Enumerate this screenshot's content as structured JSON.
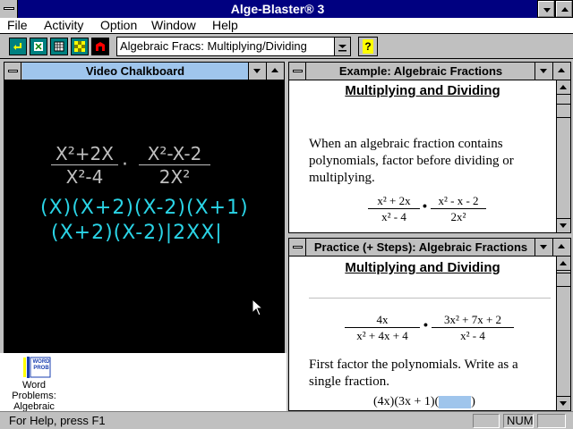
{
  "app": {
    "title": "Alge-Blaster® 3"
  },
  "menu": [
    "File",
    "Activity",
    "Option",
    "Window",
    "Help"
  ],
  "toolbar": {
    "activity_value": "Algebraic Fracs: Multiplying/Dividing",
    "help_glyph": "?"
  },
  "chalkboard": {
    "title": "Video Chalkboard",
    "expr1": {
      "num1": "X²+2X",
      "den1": "X²-4",
      "op": "·",
      "num2": "X²-X-2",
      "den2": "2X²"
    },
    "work_num": "(X)(X+2)(X-2)(X+1)",
    "work_den": "(X+2)(X-2)|2XX|"
  },
  "example": {
    "title": "Example: Algebraic Fractions",
    "heading": "Multiplying and Dividing",
    "text": "When an algebraic fraction contains polynomials, factor before dividing or multiplying.",
    "f1_num": "x² + 2x",
    "f1_den": "x² - 4",
    "f2_num": "x² - x - 2",
    "f2_den": "2x²",
    "op": "•"
  },
  "practice": {
    "title": "Practice (+ Steps): Algebraic Fractions",
    "heading": "Multiplying and Dividing",
    "f1_num": "4x",
    "f1_den": "x² + 4x + 4",
    "f2_num": "3x² + 7x + 2",
    "f2_den": "x² - 4",
    "op": "•",
    "instruction": "First factor the polynomials. Write as a single fraction.",
    "answer_partial": "(4x)(3x + 1)("
  },
  "icons": {
    "word_problems": {
      "logo_text": "WORD PROB",
      "label": "Word Problems: Algebraic"
    }
  },
  "status": {
    "help_text": "For Help, press F1",
    "num": "NUM"
  }
}
